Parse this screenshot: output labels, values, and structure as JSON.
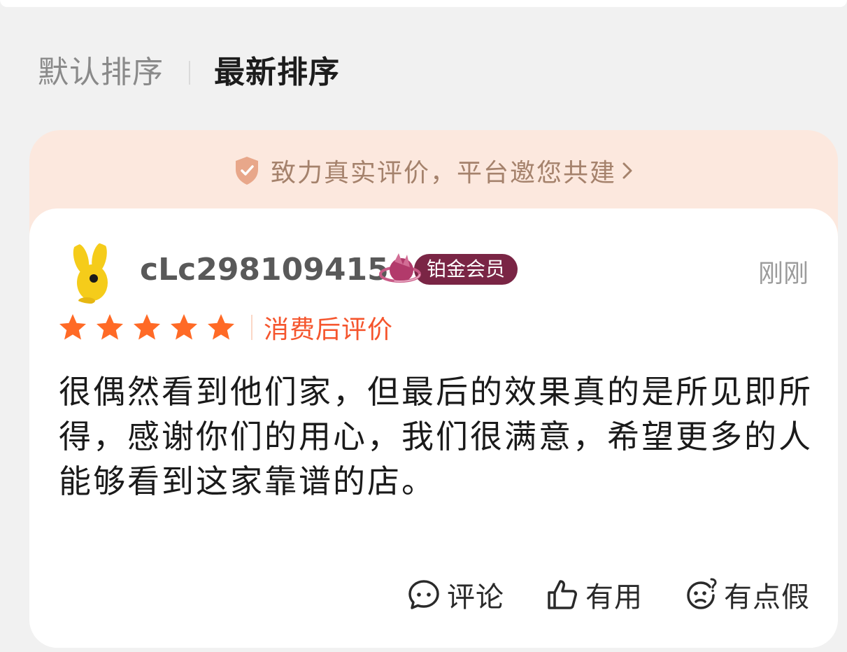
{
  "sort": {
    "default_label": "默认排序",
    "latest_label": "最新排序"
  },
  "banner": {
    "text": "致力真实评价，平台邀您共建",
    "icon": "shield-check-icon"
  },
  "review": {
    "username": "cLc298109415",
    "badge": "铂金会员",
    "time": "刚刚",
    "rating": 5,
    "rating_max": 5,
    "rating_tag": "消费后评价",
    "text": "很偶然看到他们家，但最后的效果真的是所见即所得，感谢你们的用心，我们很满意，希望更多的人能够看到这家靠谱的店。"
  },
  "actions": {
    "comment_label": "评论",
    "useful_label": "有用",
    "fake_label": "有点假"
  },
  "colors": {
    "accent_orange": "#f5552d",
    "star": "#ff6a26",
    "badge": "#7a2545",
    "banner_bg": "#fce8de"
  }
}
